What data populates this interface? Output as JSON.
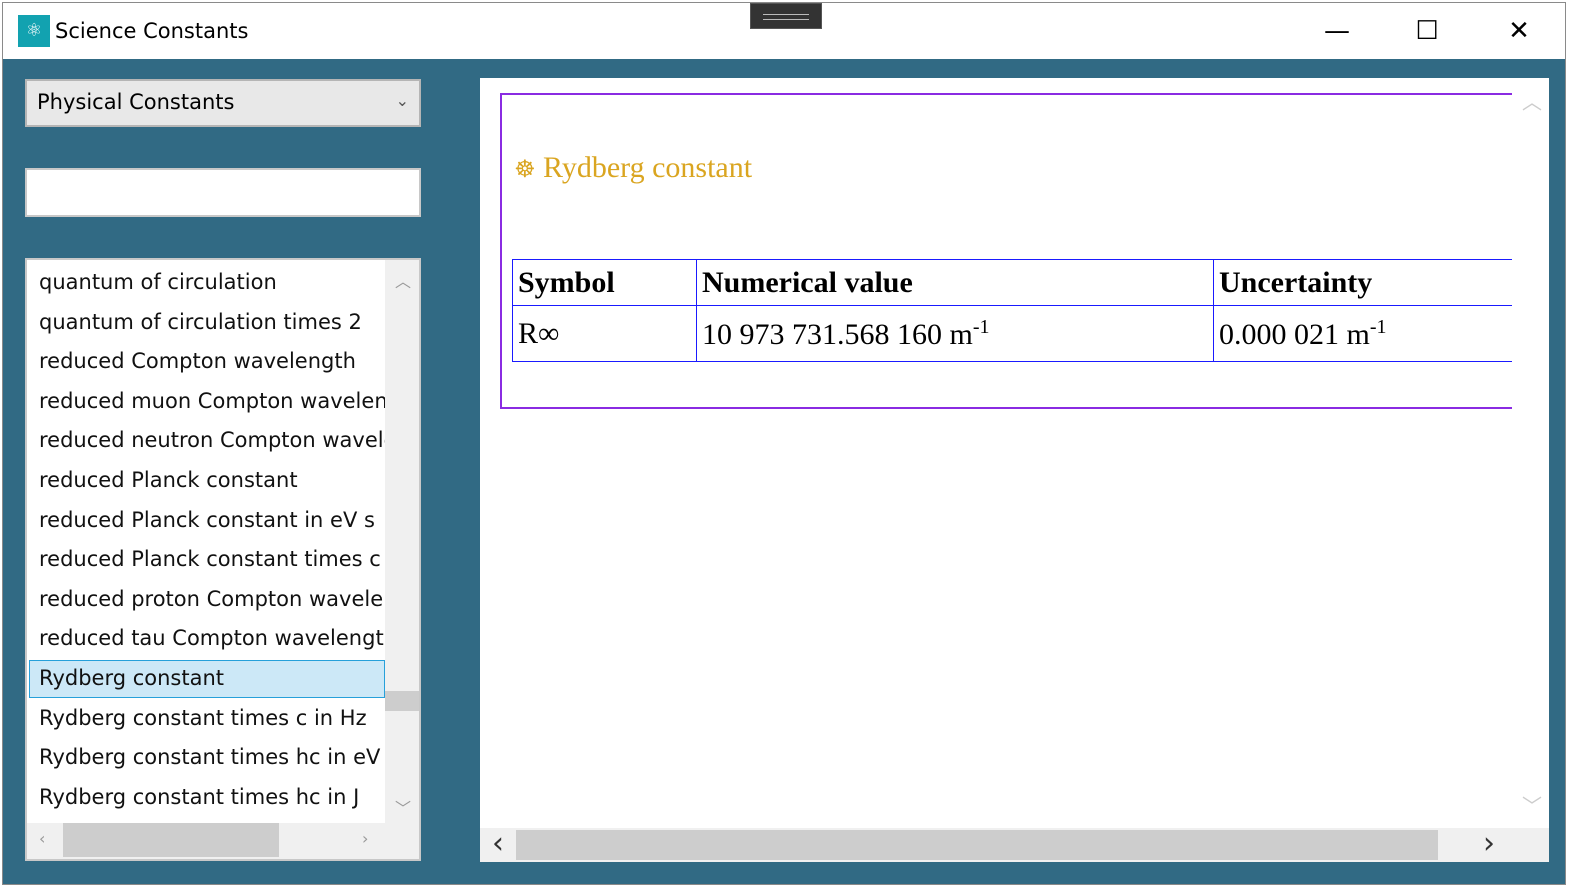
{
  "window": {
    "title": "Science Constants",
    "icon": "science-logo-icon",
    "minimize": "—",
    "maximize": "☐",
    "close": "✕"
  },
  "sidebar": {
    "category": "Physical Constants",
    "search": {
      "value": "",
      "placeholder": ""
    },
    "items": [
      "quantum of circulation",
      "quantum of circulation times 2",
      "reduced Compton wavelength",
      "reduced muon Compton wavelength",
      "reduced neutron Compton wavelength",
      "reduced Planck constant",
      "reduced Planck constant in eV s",
      "reduced Planck constant times c",
      "reduced proton Compton wavelength",
      "reduced tau Compton wavelength",
      "Rydberg constant",
      "Rydberg constant times c in Hz",
      "Rydberg constant times hc in eV",
      "Rydberg constant times hc in J"
    ],
    "selected_index": 10
  },
  "detail": {
    "icon": "☸",
    "title": "Rydberg constant",
    "headers": [
      "Symbol",
      "Numerical value",
      "Uncertainty"
    ],
    "row": {
      "symbol": "R∞",
      "value": "10 973 731.568 160 m",
      "value_exp": "-1",
      "uncertainty": "0.000 021 m",
      "uncertainty_exp": "-1"
    }
  },
  "colors": {
    "background": "#316a84",
    "heading": "#daa520",
    "card_border": "#8a2be2",
    "table_border": "#1a1aff",
    "selection": "#cce8f7"
  }
}
